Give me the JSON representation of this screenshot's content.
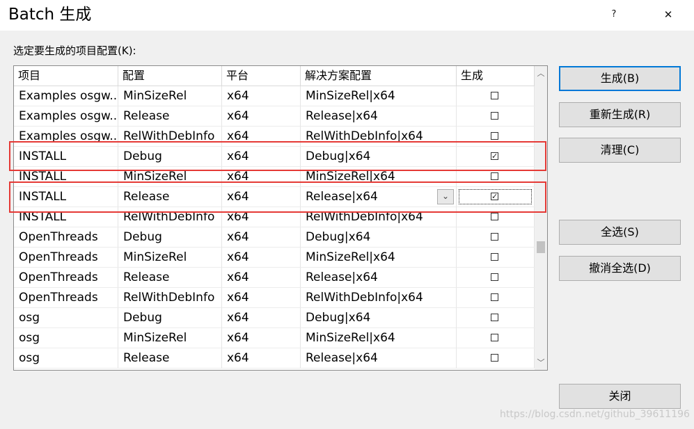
{
  "window": {
    "title": "Batch 生成",
    "help_label": "?",
    "close_label": "✕"
  },
  "prompt": "选定要生成的项目配置(K):",
  "columns": [
    "项目",
    "配置",
    "平台",
    "解决方案配置",
    "生成"
  ],
  "rows": [
    {
      "project": "Examples osgw...",
      "config": "MinSizeRel",
      "platform": "x64",
      "solution": "MinSizeRel|x64",
      "build": "☐"
    },
    {
      "project": "Examples osgw...",
      "config": "Release",
      "platform": "x64",
      "solution": "Release|x64",
      "build": "☐"
    },
    {
      "project": "Examples osgw...",
      "config": "RelWithDebInfo",
      "platform": "x64",
      "solution": "RelWithDebInfo|x64",
      "build": "☐"
    },
    {
      "project": "INSTALL",
      "config": "Debug",
      "platform": "x64",
      "solution": "Debug|x64",
      "build": "☑"
    },
    {
      "project": "INSTALL",
      "config": "MinSizeRel",
      "platform": "x64",
      "solution": "MinSizeRel|x64",
      "build": "☐"
    },
    {
      "project": "INSTALL",
      "config": "Release",
      "platform": "x64",
      "solution": "Release|x64",
      "build": "☑"
    },
    {
      "project": "INSTALL",
      "config": "RelWithDebInfo",
      "platform": "x64",
      "solution": "RelWithDebInfo|x64",
      "build": "☐"
    },
    {
      "project": "OpenThreads",
      "config": "Debug",
      "platform": "x64",
      "solution": "Debug|x64",
      "build": "☐"
    },
    {
      "project": "OpenThreads",
      "config": "MinSizeRel",
      "platform": "x64",
      "solution": "MinSizeRel|x64",
      "build": "☐"
    },
    {
      "project": "OpenThreads",
      "config": "Release",
      "platform": "x64",
      "solution": "Release|x64",
      "build": "☐"
    },
    {
      "project": "OpenThreads",
      "config": "RelWithDebInfo",
      "platform": "x64",
      "solution": "RelWithDebInfo|x64",
      "build": "☐"
    },
    {
      "project": "osg",
      "config": "Debug",
      "platform": "x64",
      "solution": "Debug|x64",
      "build": "☐"
    },
    {
      "project": "osg",
      "config": "MinSizeRel",
      "platform": "x64",
      "solution": "MinSizeRel|x64",
      "build": "☐"
    },
    {
      "project": "osg",
      "config": "Release",
      "platform": "x64",
      "solution": "Release|x64",
      "build": "☐"
    }
  ],
  "dropdown_arrow": "⌄",
  "scroll": {
    "up": "︿",
    "down": "﹀"
  },
  "buttons": {
    "build": "生成(B)",
    "rebuild": "重新生成(R)",
    "clean": "清理(C)",
    "select_all": "全选(S)",
    "deselect_all": "撤消全选(D)",
    "close": "关闭"
  },
  "watermark": "https://blog.csdn.net/github_39611196",
  "colors": {
    "highlight_border": "#e53935",
    "primary_border": "#0078d7"
  }
}
